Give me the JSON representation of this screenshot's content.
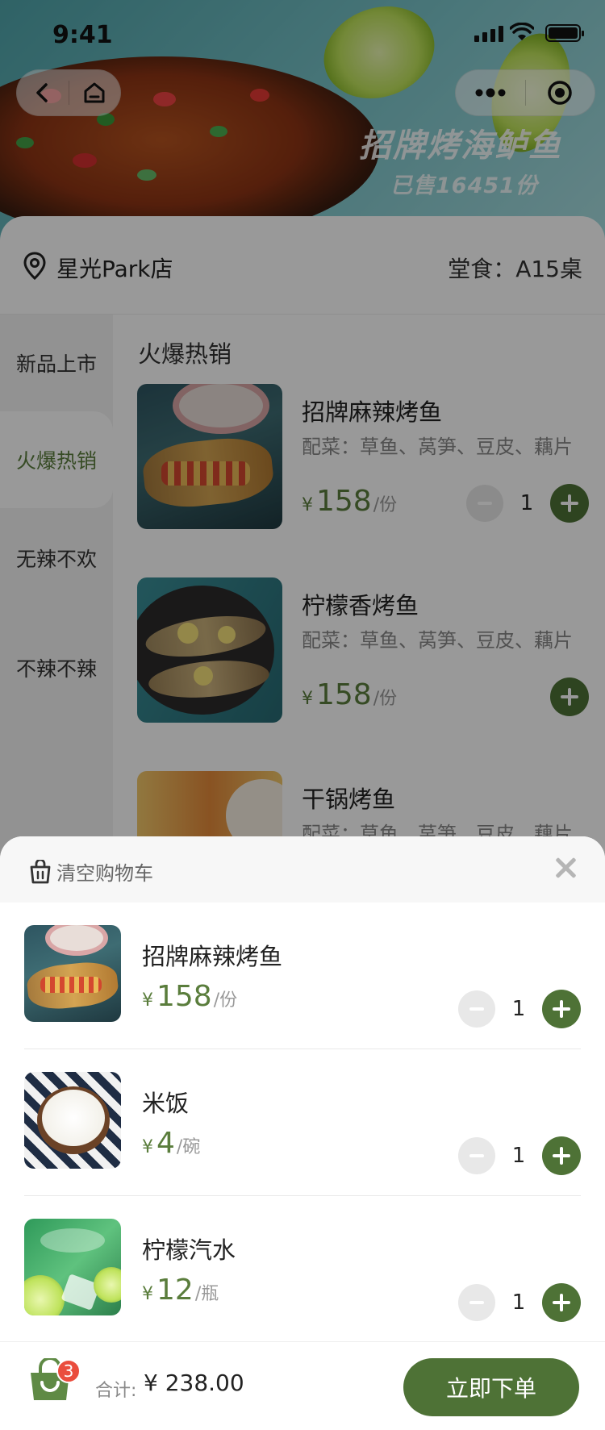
{
  "status_bar": {
    "time": "9:41"
  },
  "banner": {
    "title": "招牌烤海鲈鱼",
    "subtitle": "已售16451份"
  },
  "capsule": {
    "left": [
      "back-icon",
      "home-icon"
    ],
    "right": [
      "more-icon",
      "target-icon"
    ]
  },
  "store": {
    "name": "星光Park店",
    "dine_label": "堂食：",
    "table": "A15桌"
  },
  "sidebar": {
    "categories": [
      {
        "label": "新品上市",
        "active": false
      },
      {
        "label": "火爆热销",
        "active": true
      },
      {
        "label": "无辣不欢",
        "active": false
      },
      {
        "label": "不辣不辣",
        "active": false
      }
    ]
  },
  "menu": {
    "section_title": "火爆热销",
    "dishes": [
      {
        "name": "招牌麻辣烤鱼",
        "sides": "配菜：草鱼、莴笋、豆皮、藕片",
        "currency": "¥",
        "price": "158",
        "unit": "/份",
        "qty": "1"
      },
      {
        "name": "柠檬香烤鱼",
        "sides": "配菜：草鱼、莴笋、豆皮、藕片",
        "currency": "¥",
        "price": "158",
        "unit": "/份"
      },
      {
        "name": "干锅烤鱼",
        "sides": "配菜：草鱼、莴笋、豆皮、藕片"
      }
    ]
  },
  "cart": {
    "clear_label": "清空购物车",
    "items": [
      {
        "name": "招牌麻辣烤鱼",
        "currency": "¥",
        "price": "158",
        "unit": "/份",
        "qty": "1"
      },
      {
        "name": "米饭",
        "currency": "¥",
        "price": "4",
        "unit": "/碗",
        "qty": "1"
      },
      {
        "name": "柠檬汽水",
        "currency": "¥",
        "price": "12",
        "unit": "/瓶",
        "qty": "1"
      }
    ]
  },
  "checkout": {
    "badge_count": "3",
    "total_label": "合计:",
    "total_value": "¥ 238.00",
    "order_button": "立即下单"
  },
  "colors": {
    "accent": "#4e7236",
    "price": "#5a7d3c",
    "badge": "#ea4d3d",
    "overlay": "rgba(0,0,0,0.4)"
  }
}
